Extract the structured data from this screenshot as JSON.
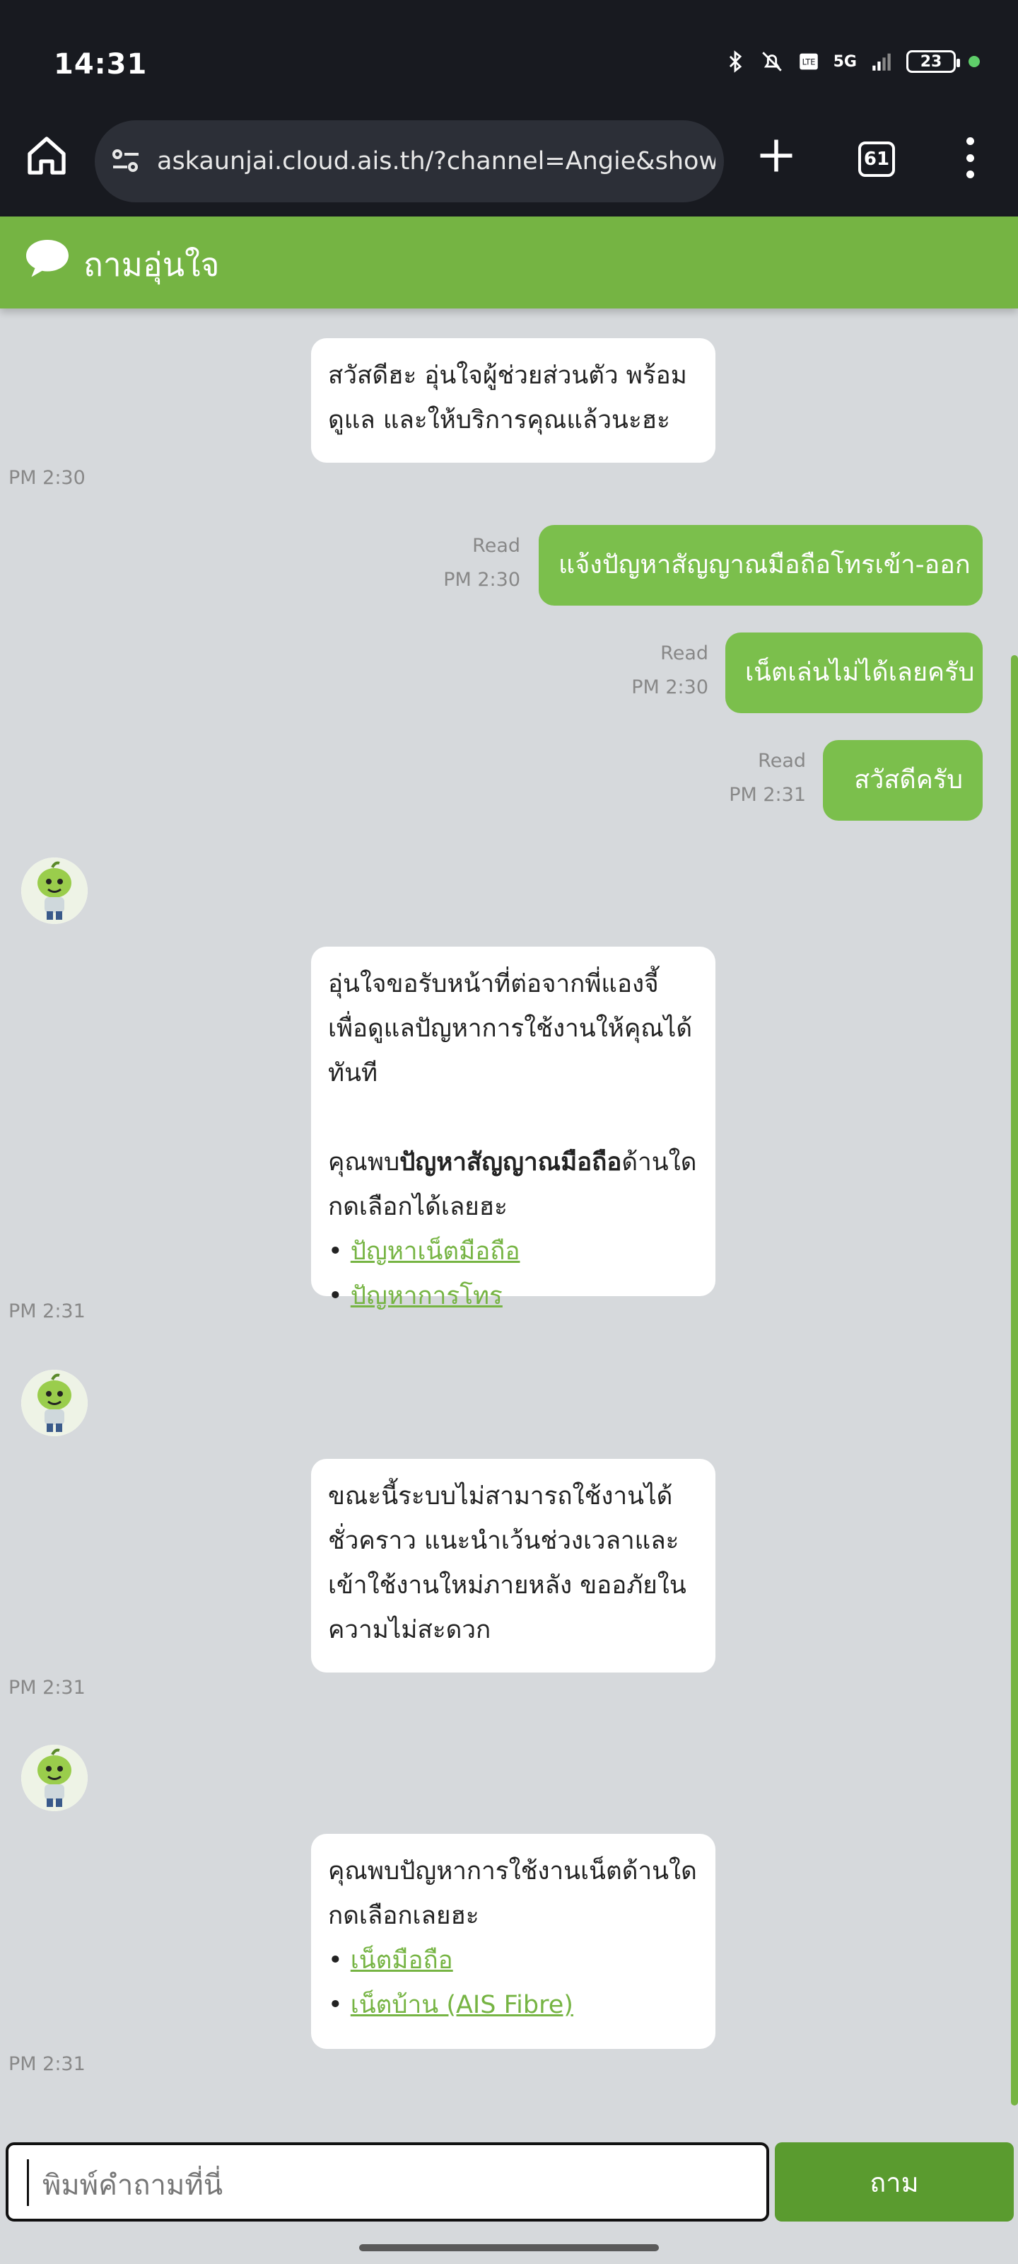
{
  "status": {
    "time": "14:31",
    "network": "5G",
    "battery": "23"
  },
  "browser": {
    "url": "askaunjai.cloud.ais.th/?channel=Angie&showMs",
    "tab_count": "61"
  },
  "header": {
    "title": "ถามอุ่นใจ"
  },
  "messages": {
    "m1": {
      "text": "สวัสดีฮะ อุ่นใจผู้ช่วยส่วนตัว พร้อมดูแล และให้บริการคุณแล้วนะฮะ",
      "time": "PM 2:30"
    },
    "u1": {
      "text": "แจ้งปัญหาสัญญาณมือถือโทรเข้า-ออก",
      "status": "Read",
      "time": "PM 2:30"
    },
    "u2": {
      "text": "เน็ตเล่นไม่ได้เลยครับ",
      "status": "Read",
      "time": "PM 2:30"
    },
    "u3": {
      "text": "สวัสดีครับ",
      "status": "Read",
      "time": "PM 2:31"
    },
    "m2": {
      "intro": "อุ่นใจขอรับหน้าที่ต่อจากพี่แองจี้ เพื่อดูแลปัญหาการใช้งานให้คุณได้ทันที",
      "q_prefix": "คุณพบ",
      "q_bold": "ปัญหาสัญญาณมือถือ",
      "q_suffix": "ด้านใด กดเลือกได้เลยฮะ",
      "option1": "ปัญหาเน็ตมือถือ",
      "option2": "ปัญหาการโทร",
      "time": "PM 2:31"
    },
    "m3": {
      "text": "ขณะนี้ระบบไม่สามารถใช้งานได้ชั่วคราว แนะนำเว้นช่วงเวลาและเข้าใช้งานใหม่ภายหลัง ขออภัยในความไม่สะดวก",
      "time": "PM 2:31"
    },
    "m4": {
      "text": "คุณพบปัญหาการใช้งานเน็ตด้านใด กดเลือกเลยฮะ",
      "option1": "เน็ตมือถือ",
      "option2": "เน็ตบ้าน (AIS Fibre)",
      "time": "PM 2:31"
    }
  },
  "input": {
    "placeholder": "พิมพ์คำถามที่นี่",
    "send_label": "ถาม"
  },
  "colors": {
    "brand_green": "#75b443",
    "user_bubble": "#7bbf4c",
    "button_green": "#5a9b2f",
    "chat_bg": "#d6d9dc"
  }
}
